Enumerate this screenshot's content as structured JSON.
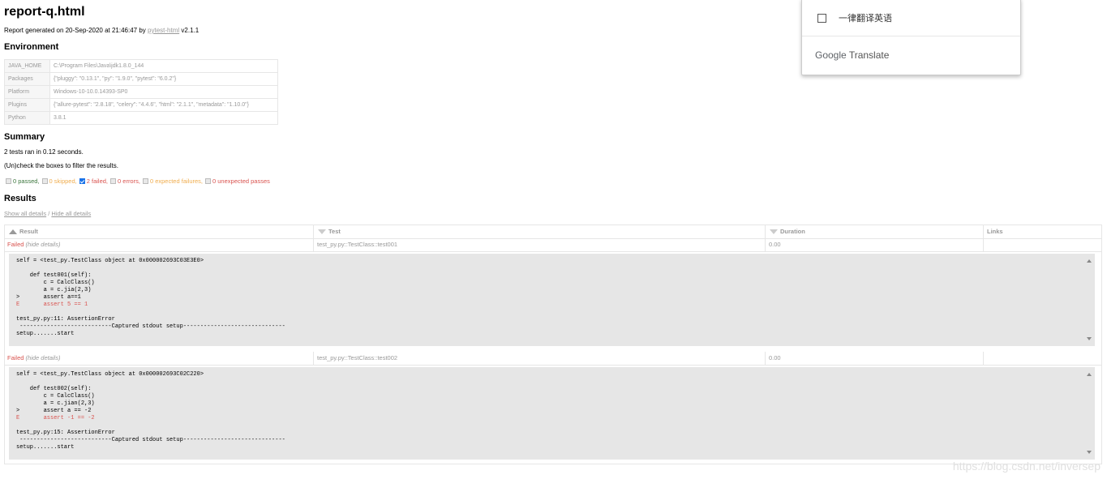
{
  "page": {
    "title": "report-q.html",
    "generated_prefix": "Report generated on 20-Sep-2020 at 21:46:47 by",
    "generator_link": "pytest-html",
    "generator_version": "v2.1.1"
  },
  "environment": {
    "heading": "Environment",
    "rows": [
      {
        "key": "JAVA_HOME",
        "value": "C:\\Program Files\\Java\\jdk1.8.0_144"
      },
      {
        "key": "Packages",
        "value": "{\"pluggy\": \"0.13.1\", \"py\": \"1.9.0\", \"pytest\": \"6.0.2\"}"
      },
      {
        "key": "Platform",
        "value": "Windows-10-10.0.14393-SP0"
      },
      {
        "key": "Plugins",
        "value": "{\"allure-pytest\": \"2.8.18\", \"celery\": \"4.4.6\", \"html\": \"2.1.1\", \"metadata\": \"1.10.0\"}"
      },
      {
        "key": "Python",
        "value": "3.8.1"
      }
    ]
  },
  "summary": {
    "heading": "Summary",
    "ran": "2 tests ran in 0.12 seconds.",
    "hint": "(Un)check the boxes to filter the results.",
    "filters": [
      {
        "label": "0 passed,",
        "checked": false,
        "color": "#3c763d"
      },
      {
        "label": "0 skipped,",
        "checked": false,
        "color": "#f0ad4e"
      },
      {
        "label": "2 failed,",
        "checked": true,
        "color": "#d9534f"
      },
      {
        "label": "0 errors,",
        "checked": false,
        "color": "#d9534f"
      },
      {
        "label": "0 expected failures,",
        "checked": false,
        "color": "#f0ad4e"
      },
      {
        "label": "0 unexpected passes",
        "checked": false,
        "color": "#d9534f"
      }
    ]
  },
  "results": {
    "heading": "Results",
    "show_all": "Show all details",
    "separator": "/",
    "hide_all": "Hide all details",
    "columns": [
      "Result",
      "Test",
      "Duration",
      "Links"
    ],
    "rows": [
      {
        "result": "Failed",
        "details_toggle": "(hide details)",
        "test": "test_py.py::TestClass::test001",
        "duration": "0.00",
        "links": "",
        "log_lines": [
          {
            "text": "self = <test_py.TestClass object at 0x000002693C03E3E0>",
            "err": false
          },
          {
            "text": "",
            "err": false
          },
          {
            "text": "    def test001(self):",
            "err": false
          },
          {
            "text": "        c = CalcClass()",
            "err": false
          },
          {
            "text": "        a = c.jia(2,3)",
            "err": false
          },
          {
            "text": ">       assert a==1",
            "err": false
          },
          {
            "text": "E       assert 5 == 1",
            "err": true
          },
          {
            "text": "",
            "err": false
          },
          {
            "text": "test_py.py:11: AssertionError",
            "err": false
          },
          {
            "text": " ---------------------------Captured stdout setup------------------------------",
            "err": false
          },
          {
            "text": "setup.......start",
            "err": false
          }
        ]
      },
      {
        "result": "Failed",
        "details_toggle": "(hide details)",
        "test": "test_py.py::TestClass::test002",
        "duration": "0.00",
        "links": "",
        "log_lines": [
          {
            "text": "self = <test_py.TestClass object at 0x000002693C02C220>",
            "err": false
          },
          {
            "text": "",
            "err": false
          },
          {
            "text": "    def test002(self):",
            "err": false
          },
          {
            "text": "        c = CalcClass()",
            "err": false
          },
          {
            "text": "        a = c.jian(2,3)",
            "err": false
          },
          {
            "text": ">       assert a == -2",
            "err": false
          },
          {
            "text": "E       assert -1 == -2",
            "err": true
          },
          {
            "text": "",
            "err": false
          },
          {
            "text": "test_py.py:15: AssertionError",
            "err": false
          },
          {
            "text": " ---------------------------Captured stdout setup------------------------------",
            "err": false
          },
          {
            "text": "setup.......start",
            "err": false
          }
        ]
      }
    ]
  },
  "translate_popup": {
    "option": "一律翻译英语",
    "brand_google": "Google",
    "brand_translate": "Translate"
  },
  "watermark": "https://blog.csdn.net/inversep"
}
